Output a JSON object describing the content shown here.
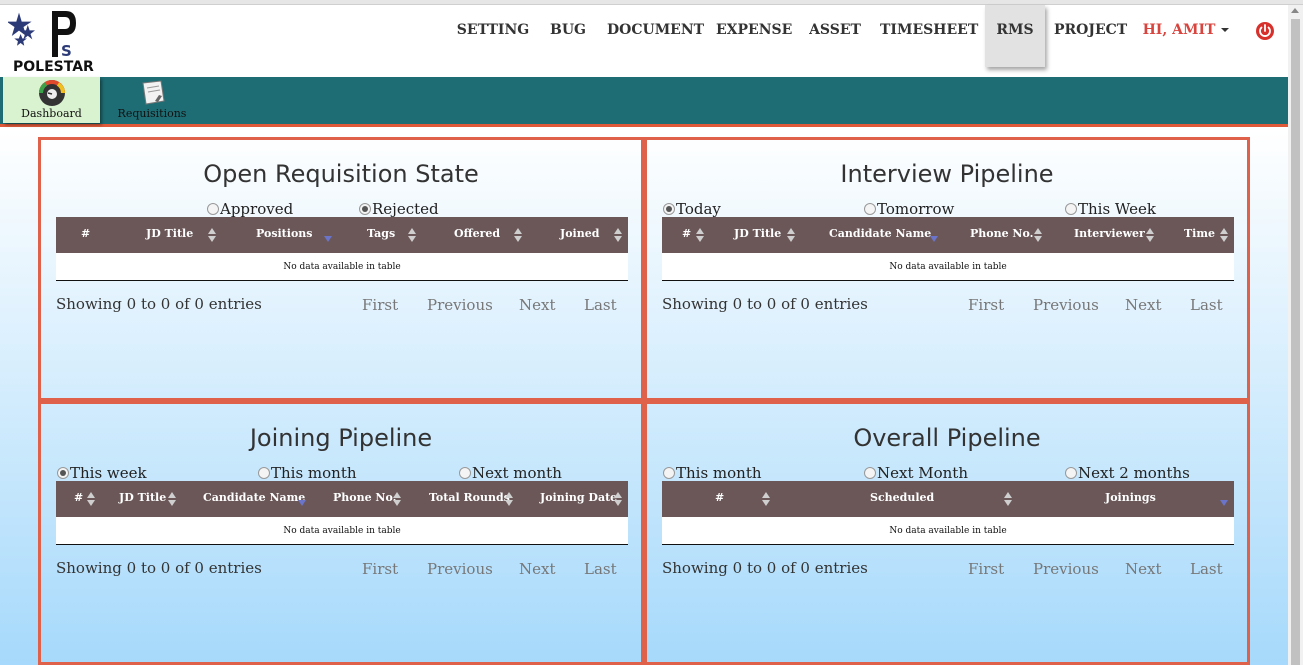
{
  "brand": {
    "logo_text": "POLESTAR"
  },
  "nav": {
    "items": [
      "SETTING",
      "BUG",
      "DOCUMENT",
      "EXPENSE",
      "ASSET",
      "TIMESHEET",
      "RMS",
      "PROJECT"
    ],
    "active": "RMS",
    "user_label": "HI, AMIT",
    "power_icon": "power-icon",
    "user_color": "#d8453f"
  },
  "subnav": {
    "items": [
      {
        "label": "Dashboard",
        "icon": "gauge-icon",
        "active": true
      },
      {
        "label": "Requisitions",
        "icon": "document-icon",
        "active": false
      }
    ],
    "bg_color": "#1e6d74",
    "accent_color": "#e05a3a"
  },
  "panels": {
    "open_requisition": {
      "title": "Open Requisition State",
      "radios": [
        {
          "label": "Approved",
          "checked": false
        },
        {
          "label": "Rejected",
          "checked": true
        }
      ],
      "columns": [
        "#",
        "JD Title",
        "Positions",
        "Tags",
        "Offered",
        "Joined"
      ],
      "empty": "No data available in table",
      "info": "Showing 0 to 0 of 0 entries",
      "pager": [
        "First",
        "Previous",
        "Next",
        "Last"
      ]
    },
    "interview_pipeline": {
      "title": "Interview Pipeline",
      "radios": [
        {
          "label": "Today",
          "checked": true
        },
        {
          "label": "Tomorrow",
          "checked": false
        },
        {
          "label": "This Week",
          "checked": false
        }
      ],
      "columns": [
        "#",
        "JD Title",
        "Candidate Name",
        "Phone No.",
        "Interviewer",
        "Time"
      ],
      "empty": "No data available in table",
      "info": "Showing 0 to 0 of 0 entries",
      "pager": [
        "First",
        "Previous",
        "Next",
        "Last"
      ]
    },
    "joining_pipeline": {
      "title": "Joining Pipeline",
      "radios": [
        {
          "label": "This week",
          "checked": true
        },
        {
          "label": "This month",
          "checked": false
        },
        {
          "label": "Next month",
          "checked": false
        }
      ],
      "columns": [
        "#",
        "JD Title",
        "Candidate Name",
        "Phone No.",
        "Total Rounds",
        "Joining Date"
      ],
      "empty": "No data available in table",
      "info": "Showing 0 to 0 of 0 entries",
      "pager": [
        "First",
        "Previous",
        "Next",
        "Last"
      ]
    },
    "overall_pipeline": {
      "title": "Overall Pipeline",
      "radios": [
        {
          "label": "This month",
          "checked": false
        },
        {
          "label": "Next Month",
          "checked": false
        },
        {
          "label": "Next 2 months",
          "checked": false
        }
      ],
      "columns": [
        "#",
        "Scheduled",
        "Joinings"
      ],
      "empty": "No data available in table",
      "info": "Showing 0 to 0 of 0 entries",
      "pager": [
        "First",
        "Previous",
        "Next",
        "Last"
      ]
    }
  },
  "colors": {
    "panel_border": "#e0614a",
    "table_header": "#6b5758",
    "sort_desc": "#6a74c8"
  }
}
